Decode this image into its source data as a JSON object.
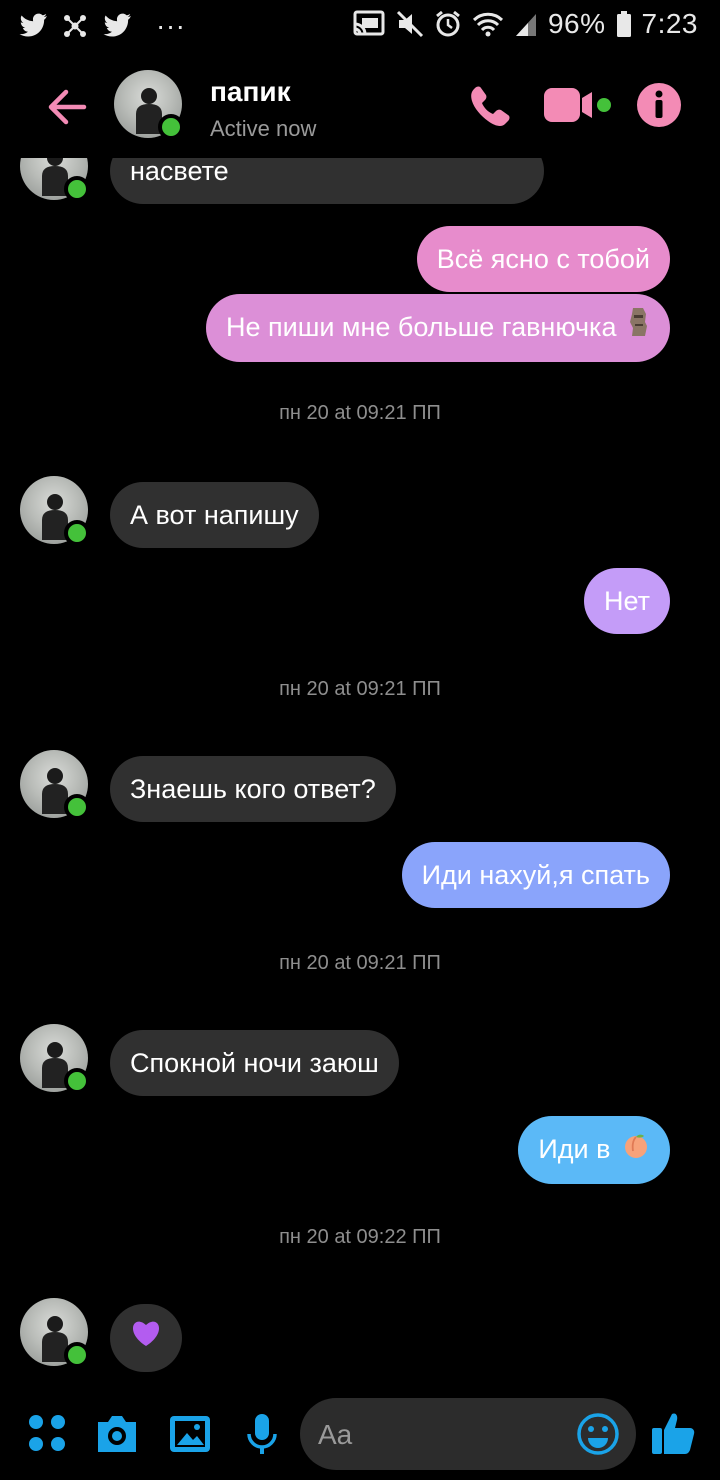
{
  "status_bar": {
    "battery": "96%",
    "time": "7:23",
    "more": "···"
  },
  "header": {
    "contact_name": "папик",
    "contact_status": "Active now"
  },
  "messages": [
    {
      "side": "in",
      "text": "насвете"
    },
    {
      "side": "out",
      "text": "Всё ясно с тобой"
    },
    {
      "side": "out",
      "text": "Не пиши мне больше гавнючка",
      "emoji": "moai"
    },
    {
      "timestamp": "пн 20 at 09:21 ПП"
    },
    {
      "side": "in",
      "text": "А вот напишу"
    },
    {
      "side": "out",
      "text": "Нет"
    },
    {
      "timestamp": "пн 20 at 09:21 ПП"
    },
    {
      "side": "in",
      "text": "Знаешь кого ответ?"
    },
    {
      "side": "out",
      "text": "Иди нахуй,я спать"
    },
    {
      "timestamp": "пн 20 at 09:21 ПП"
    },
    {
      "side": "in",
      "text": "Спокной ночи заюш"
    },
    {
      "side": "out",
      "text": "Иди в",
      "emoji": "peach"
    },
    {
      "timestamp": "пн 20 at 09:22 ПП"
    },
    {
      "side": "in",
      "emoji": "purple-heart"
    }
  ],
  "composer": {
    "placeholder": "Aa"
  },
  "colors": {
    "accent_pink": "#f38bb5",
    "bubble_in": "#303030",
    "bubble_out_pink": "#e78ccc",
    "bubble_out_violet": "#c49cf8",
    "bubble_out_blue": "#8aa4fb",
    "bubble_out_cyan": "#5bb9f7",
    "composer_icons": "#1aa3e8",
    "online_dot": "#44c13a"
  }
}
